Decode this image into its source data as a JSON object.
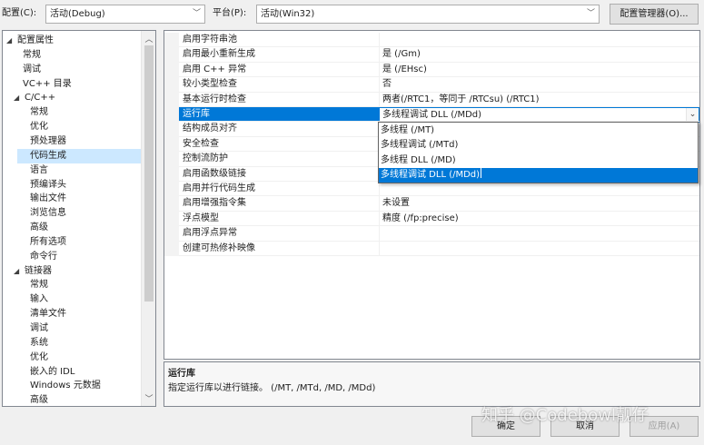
{
  "toolbar": {
    "config_label": "配置(C):",
    "config_value": "活动(Debug)",
    "platform_label": "平台(P):",
    "platform_value": "活动(Win32)",
    "config_manager_label": "配置管理器(O)..."
  },
  "tree": {
    "items": [
      {
        "label": "配置属性",
        "toggle": "◢"
      },
      {
        "label": "常规"
      },
      {
        "label": "调试"
      },
      {
        "label": "VC++ 目录"
      },
      {
        "label": "C/C++",
        "toggle": "◢"
      },
      {
        "label": "常规"
      },
      {
        "label": "优化"
      },
      {
        "label": "预处理器"
      },
      {
        "label": "代码生成",
        "selected": true
      },
      {
        "label": "语言"
      },
      {
        "label": "预编译头"
      },
      {
        "label": "输出文件"
      },
      {
        "label": "浏览信息"
      },
      {
        "label": "高级"
      },
      {
        "label": "所有选项"
      },
      {
        "label": "命令行"
      },
      {
        "label": "链接器",
        "toggle": "◢"
      },
      {
        "label": "常规"
      },
      {
        "label": "输入"
      },
      {
        "label": "清单文件"
      },
      {
        "label": "调试"
      },
      {
        "label": "系统"
      },
      {
        "label": "优化"
      },
      {
        "label": "嵌入的 IDL"
      },
      {
        "label": "Windows 元数据"
      },
      {
        "label": "高级"
      }
    ]
  },
  "properties": [
    {
      "name": "启用字符串池",
      "value": ""
    },
    {
      "name": "启用最小重新生成",
      "value": "是 (/Gm)"
    },
    {
      "name": "启用 C++ 异常",
      "value": "是 (/EHsc)"
    },
    {
      "name": "较小类型检查",
      "value": "否"
    },
    {
      "name": "基本运行时检查",
      "value": "两者(/RTC1，等同于 /RTCsu) (/RTC1)"
    },
    {
      "name": "运行库",
      "value": "多线程调试 DLL (/MDd)"
    },
    {
      "name": "结构成员对齐",
      "value": ""
    },
    {
      "name": "安全检查",
      "value": ""
    },
    {
      "name": "控制流防护",
      "value": ""
    },
    {
      "name": "启用函数级链接",
      "value": ""
    },
    {
      "name": "启用并行代码生成",
      "value": ""
    },
    {
      "name": "启用增强指令集",
      "value": "未设置"
    },
    {
      "name": "浮点模型",
      "value": "精度 (/fp:precise)"
    },
    {
      "name": "启用浮点异常",
      "value": ""
    },
    {
      "name": "创建可热修补映像",
      "value": ""
    }
  ],
  "dropdown": {
    "options": [
      "多线程 (/MT)",
      "多线程调试 (/MTd)",
      "多线程 DLL (/MD)",
      "多线程调试 DLL (/MDd)"
    ],
    "selected_index": 3
  },
  "description": {
    "title": "运行库",
    "text": "指定运行库以进行链接。    (/MT, /MTd, /MD, /MDd)"
  },
  "buttons": {
    "ok": "确定",
    "cancel": "取消",
    "apply": "应用(A)"
  },
  "watermark": "知乎 @Codebowl靓仔"
}
